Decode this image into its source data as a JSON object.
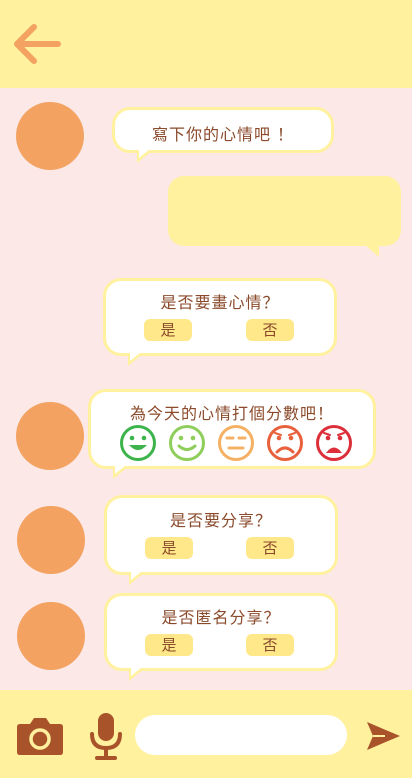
{
  "colors": {
    "accent": "#f4a261",
    "bar": "#fff19e",
    "background": "#fce8e6",
    "text": "#8b4a2b"
  },
  "header": {
    "back_icon": "arrow-left-icon"
  },
  "messages": {
    "prompt_mood": "寫下你的心情吧 ！",
    "draw_mood": {
      "question": "是否要畫心情？",
      "yes": "是",
      "no": "否"
    },
    "rate_day": {
      "question": "為今天的心情打個分數吧！",
      "faces": [
        "very-happy-face-icon",
        "happy-face-icon",
        "neutral-face-icon",
        "sad-face-icon",
        "very-sad-face-icon"
      ]
    },
    "share": {
      "question": "是否要分享？",
      "yes": "是",
      "no": "否"
    },
    "anonymous_share": {
      "question": "是否匿名分享？",
      "yes": "是",
      "no": "否"
    }
  },
  "composer": {
    "camera_icon": "camera-icon",
    "mic_icon": "microphone-icon",
    "input_value": "",
    "send_icon": "send-icon"
  }
}
